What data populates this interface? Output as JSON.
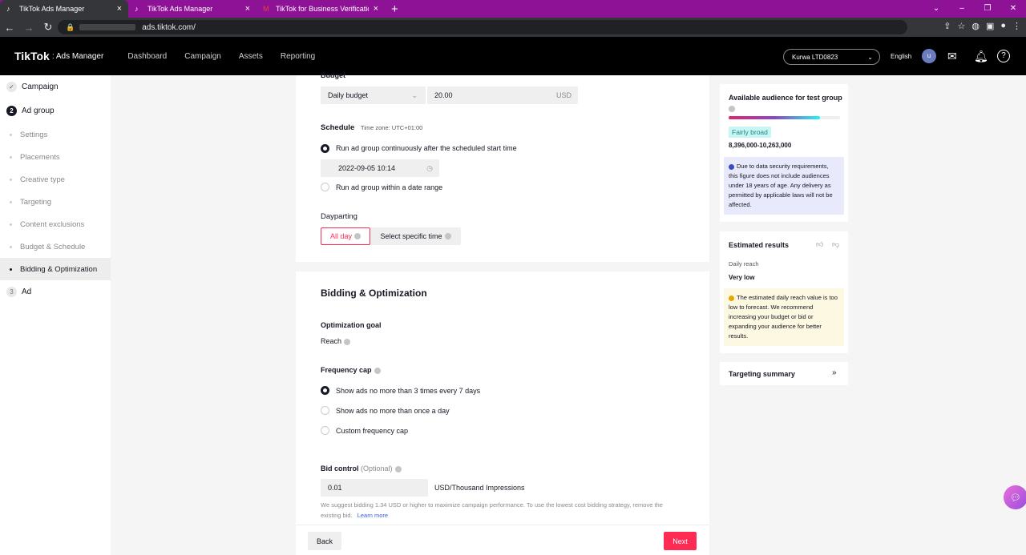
{
  "browser": {
    "tabs": [
      {
        "title": "TikTok Ads Manager",
        "active": true
      },
      {
        "title": "TikTok Ads Manager",
        "active": false
      },
      {
        "title": "TikTok for Business Verification C",
        "active": false
      }
    ],
    "new_tab": "+",
    "url": "ads.tiktok.com/"
  },
  "header": {
    "logo": "TikTok",
    "logo_sub": ": Ads Manager",
    "menu": [
      "Dashboard",
      "Campaign",
      "Assets",
      "Reporting"
    ],
    "account": "Kurwa LTD0823",
    "language": "English",
    "avatar": "u"
  },
  "sidebar": {
    "items": [
      {
        "label": "Campaign",
        "type": "step",
        "marker": "✓"
      },
      {
        "label": "Ad group",
        "type": "step",
        "marker": "2"
      },
      {
        "label": "Settings",
        "type": "sub"
      },
      {
        "label": "Placements",
        "type": "sub"
      },
      {
        "label": "Creative type",
        "type": "sub"
      },
      {
        "label": "Targeting",
        "type": "sub"
      },
      {
        "label": "Content exclusions",
        "type": "sub"
      },
      {
        "label": "Budget & Schedule",
        "type": "sub"
      },
      {
        "label": "Bidding & Optimization",
        "type": "sub",
        "selected": true
      },
      {
        "label": "Ad",
        "type": "step",
        "marker": "3"
      }
    ]
  },
  "budget": {
    "label": "Budget",
    "type": "Daily budget",
    "amount": "20.00",
    "currency": "USD"
  },
  "schedule": {
    "label": "Schedule",
    "timezone": "Time zone: UTC+01:00",
    "option1": "Run ad group continuously after the scheduled start time",
    "start": "2022-09-05 10:14",
    "option2": "Run ad group within a date range"
  },
  "dayparting": {
    "label": "Dayparting",
    "all_day": "All day",
    "specific": "Select specific time"
  },
  "bidding": {
    "title": "Bidding & Optimization",
    "goal_label": "Optimization goal",
    "goal_value": "Reach",
    "freq_label": "Frequency cap",
    "freq_options": [
      "Show ads no more than 3 times every 7 days",
      "Show ads no more than once a day",
      "Custom frequency cap"
    ],
    "bid_label": "Bid control",
    "bid_optional": "(Optional)",
    "bid_value": "0.01",
    "bid_unit": "USD/Thousand Impressions",
    "suggest1": "We suggest bidding 1.34 USD or higher to maximize campaign performance. To use the lowest cost bidding strategy, remove the",
    "suggest2": "existing bid.",
    "learn_more": "Learn more"
  },
  "footer": {
    "back": "Back",
    "next": "Next"
  },
  "audience": {
    "title": "Available audience for test group",
    "level": "Fairly broad",
    "level_fraction": 0.82,
    "range": "8,396,000-10,263,000",
    "note": "Due to data security requirements, this figure does not include audiences under 18 years of age. Any delivery as permitted by applicable laws will not be affected."
  },
  "estimated": {
    "title": "Estimated results",
    "daily_reach_label": "Daily reach",
    "daily_reach_value": "Very low",
    "note": "The estimated daily reach value is too low to forecast. We recommend increasing your budget or bid or expanding your audience for better results."
  },
  "targeting_summary": {
    "title": "Targeting summary"
  },
  "colors": {
    "accent": "#fe2c55",
    "purple_tab": "#8e1296",
    "teal": "#25f4ee",
    "info_bg": "#e8eafc",
    "warn_bg": "#fdf8e1"
  }
}
